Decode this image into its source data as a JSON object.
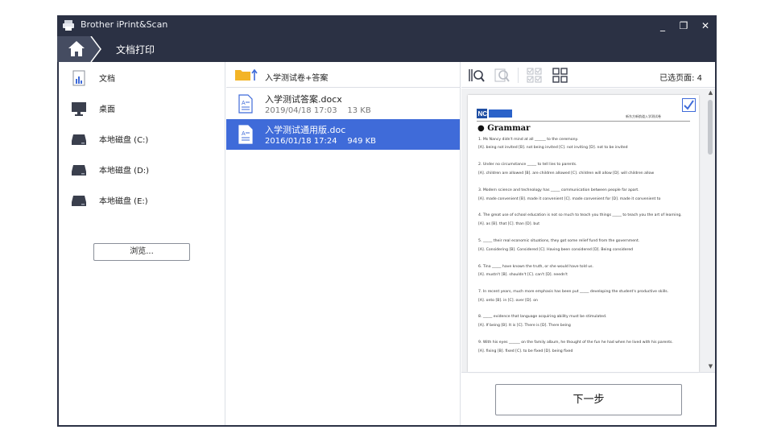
{
  "window": {
    "title": "Brother iPrint&Scan",
    "controls": {
      "minimize": "_",
      "maximize": "❐",
      "close": "✕"
    }
  },
  "nav": {
    "title": "文档打印"
  },
  "sidebar": {
    "items": [
      {
        "label": "文档",
        "icon": "documents-icon"
      },
      {
        "label": "桌面",
        "icon": "desktop-icon"
      },
      {
        "label": "本地磁盘 (C:)",
        "icon": "drive-icon"
      },
      {
        "label": "本地磁盘 (D:)",
        "icon": "drive-icon"
      },
      {
        "label": "本地磁盘 (E:)",
        "icon": "drive-icon"
      }
    ],
    "browse_label": "浏览..."
  },
  "file_pane": {
    "path": "入学测试卷+答案",
    "files": [
      {
        "name": "入学测试答案.docx",
        "date": "2019/04/18 17:03",
        "size": "13 KB",
        "selected": false
      },
      {
        "name": "入学测试通用版.doc",
        "date": "2016/01/18 17:24",
        "size": "949 KB",
        "selected": true
      }
    ]
  },
  "preview": {
    "selected_pages": "已选页面: 4",
    "page_header": "新东方新航道入学测试卷",
    "section_title": "Grammar",
    "questions": [
      [
        "1. Ms Nancy didn't mind at all ______ to the ceremony.",
        "[A]. being not invited     [B]. not being invited     [C]. not inviting     [D]. not to be invited"
      ],
      [
        "2. Under no circumstance _____ to tell lies to parents.",
        "[A]. children are allowed     [B]. are children allowed     [C]. children will allow     [D]. will children allow"
      ],
      [
        "3. Modern science and technology has _____ communication between people far apart.",
        "[A]. made convenient     [B]. made it convenient  [C]. made convenient for [D]. made it convenient to"
      ],
      [
        "4. The great use of school education is not so much to teach you things _____ to teach you the art of learning.",
        "[A]. as     [B]. that     [C]. than     [D]. but"
      ],
      [
        "5. _____ their real economic situations, they got some relief fund from the government.",
        "[A]. Considering     [B]. Considered     [C]. Having been considered     [D]. Being considered"
      ],
      [
        "6. Tina _____ have known the truth, or she would have told us.",
        "[A]. mustn't     [B]. shouldn't     [C]. can't     [D]. needn't"
      ],
      [
        "7. In recent years,    much more emphasis has been put _____ developing the student's productive skills.",
        "[A]. onto     [B]. in     [C]. over     [D]. on"
      ],
      [
        "8. _____ evidence that language acquiring ability must be stimulated.",
        "[A]. If being     [B]. It is     [C]. There is     [D]. There being"
      ],
      [
        "9. With his eyes ______ on the family album, he thought of the fun he had when he lived with his parents.",
        "[A]. fixing     [B]. fixed     [C]. to be fixed     [D]. being fixed"
      ]
    ],
    "next_label": "下一步"
  },
  "colors": {
    "chrome": "#2b3144",
    "selection": "#3f6bd9",
    "link_blue": "#3f6bd9",
    "folder_yellow": "#f3b426"
  }
}
